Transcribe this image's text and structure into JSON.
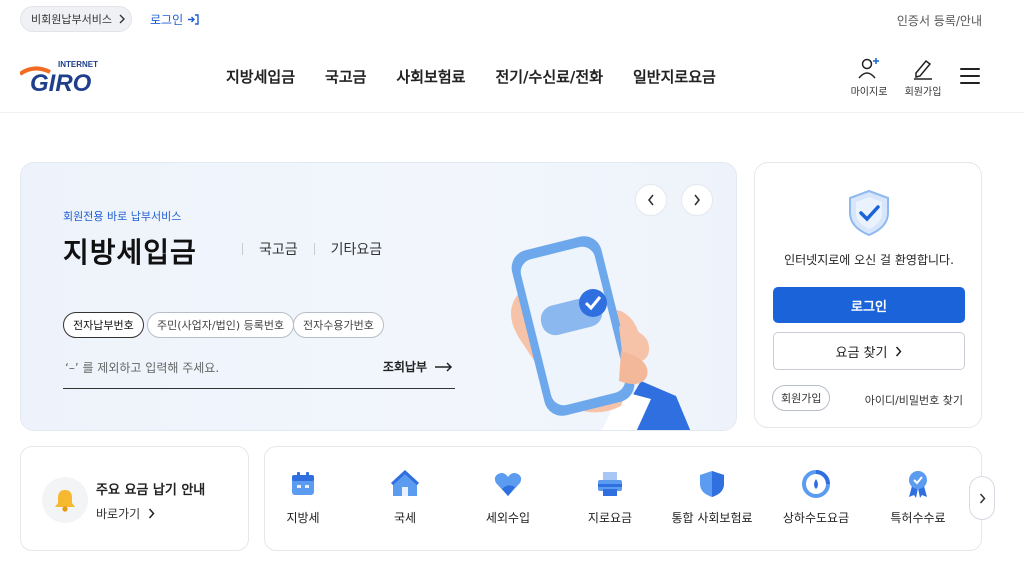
{
  "topbar": {
    "nonmember_label": "비회원납부서비스",
    "login_label": "로그인",
    "cert_label": "인증서 등록/안내"
  },
  "logo": {
    "small": "INTERNET",
    "main": "GIRO"
  },
  "nav": {
    "items": [
      "지방세입금",
      "국고금",
      "사회보험료",
      "전기/수신료/전화",
      "일반지로요금"
    ]
  },
  "header_actions": {
    "mygiro": "마이지로",
    "join": "회원가입"
  },
  "hero": {
    "subtitle": "회원전용 바로 납부서비스",
    "title": "지방세입금",
    "tabs": [
      "국고금",
      "기타요금"
    ],
    "chips": [
      "전자납부번호",
      "주민(사업자/법인) 등록번호",
      "전자수용가번호"
    ],
    "input_placeholder": "‘–’ 를 제외하고 입력해 주세요.",
    "submit_label": "조회납부"
  },
  "login_panel": {
    "welcome": "인터넷지로에 오신 걸 환영합니다.",
    "login_button": "로그인",
    "fee_button": "요금 찾기",
    "join_button": "회원가입",
    "find_link": "아이디/비밀번호 찾기"
  },
  "notice": {
    "title": "주요 요금 납기 안내",
    "link": "바로가기"
  },
  "quick_menu": {
    "items": [
      {
        "label": "지방세",
        "icon": "calendar-icon"
      },
      {
        "label": "국세",
        "icon": "house-icon"
      },
      {
        "label": "세외수입",
        "icon": "heart-icon"
      },
      {
        "label": "지로요금",
        "icon": "printer-icon"
      },
      {
        "label": "통합 사회보험료",
        "icon": "shield-icon"
      },
      {
        "label": "상하수도요금",
        "icon": "water-gauge-icon"
      },
      {
        "label": "특허수수료",
        "icon": "award-icon"
      }
    ]
  },
  "colors": {
    "accent": "#1a63d9",
    "hero_bg": "#eef3fb"
  }
}
